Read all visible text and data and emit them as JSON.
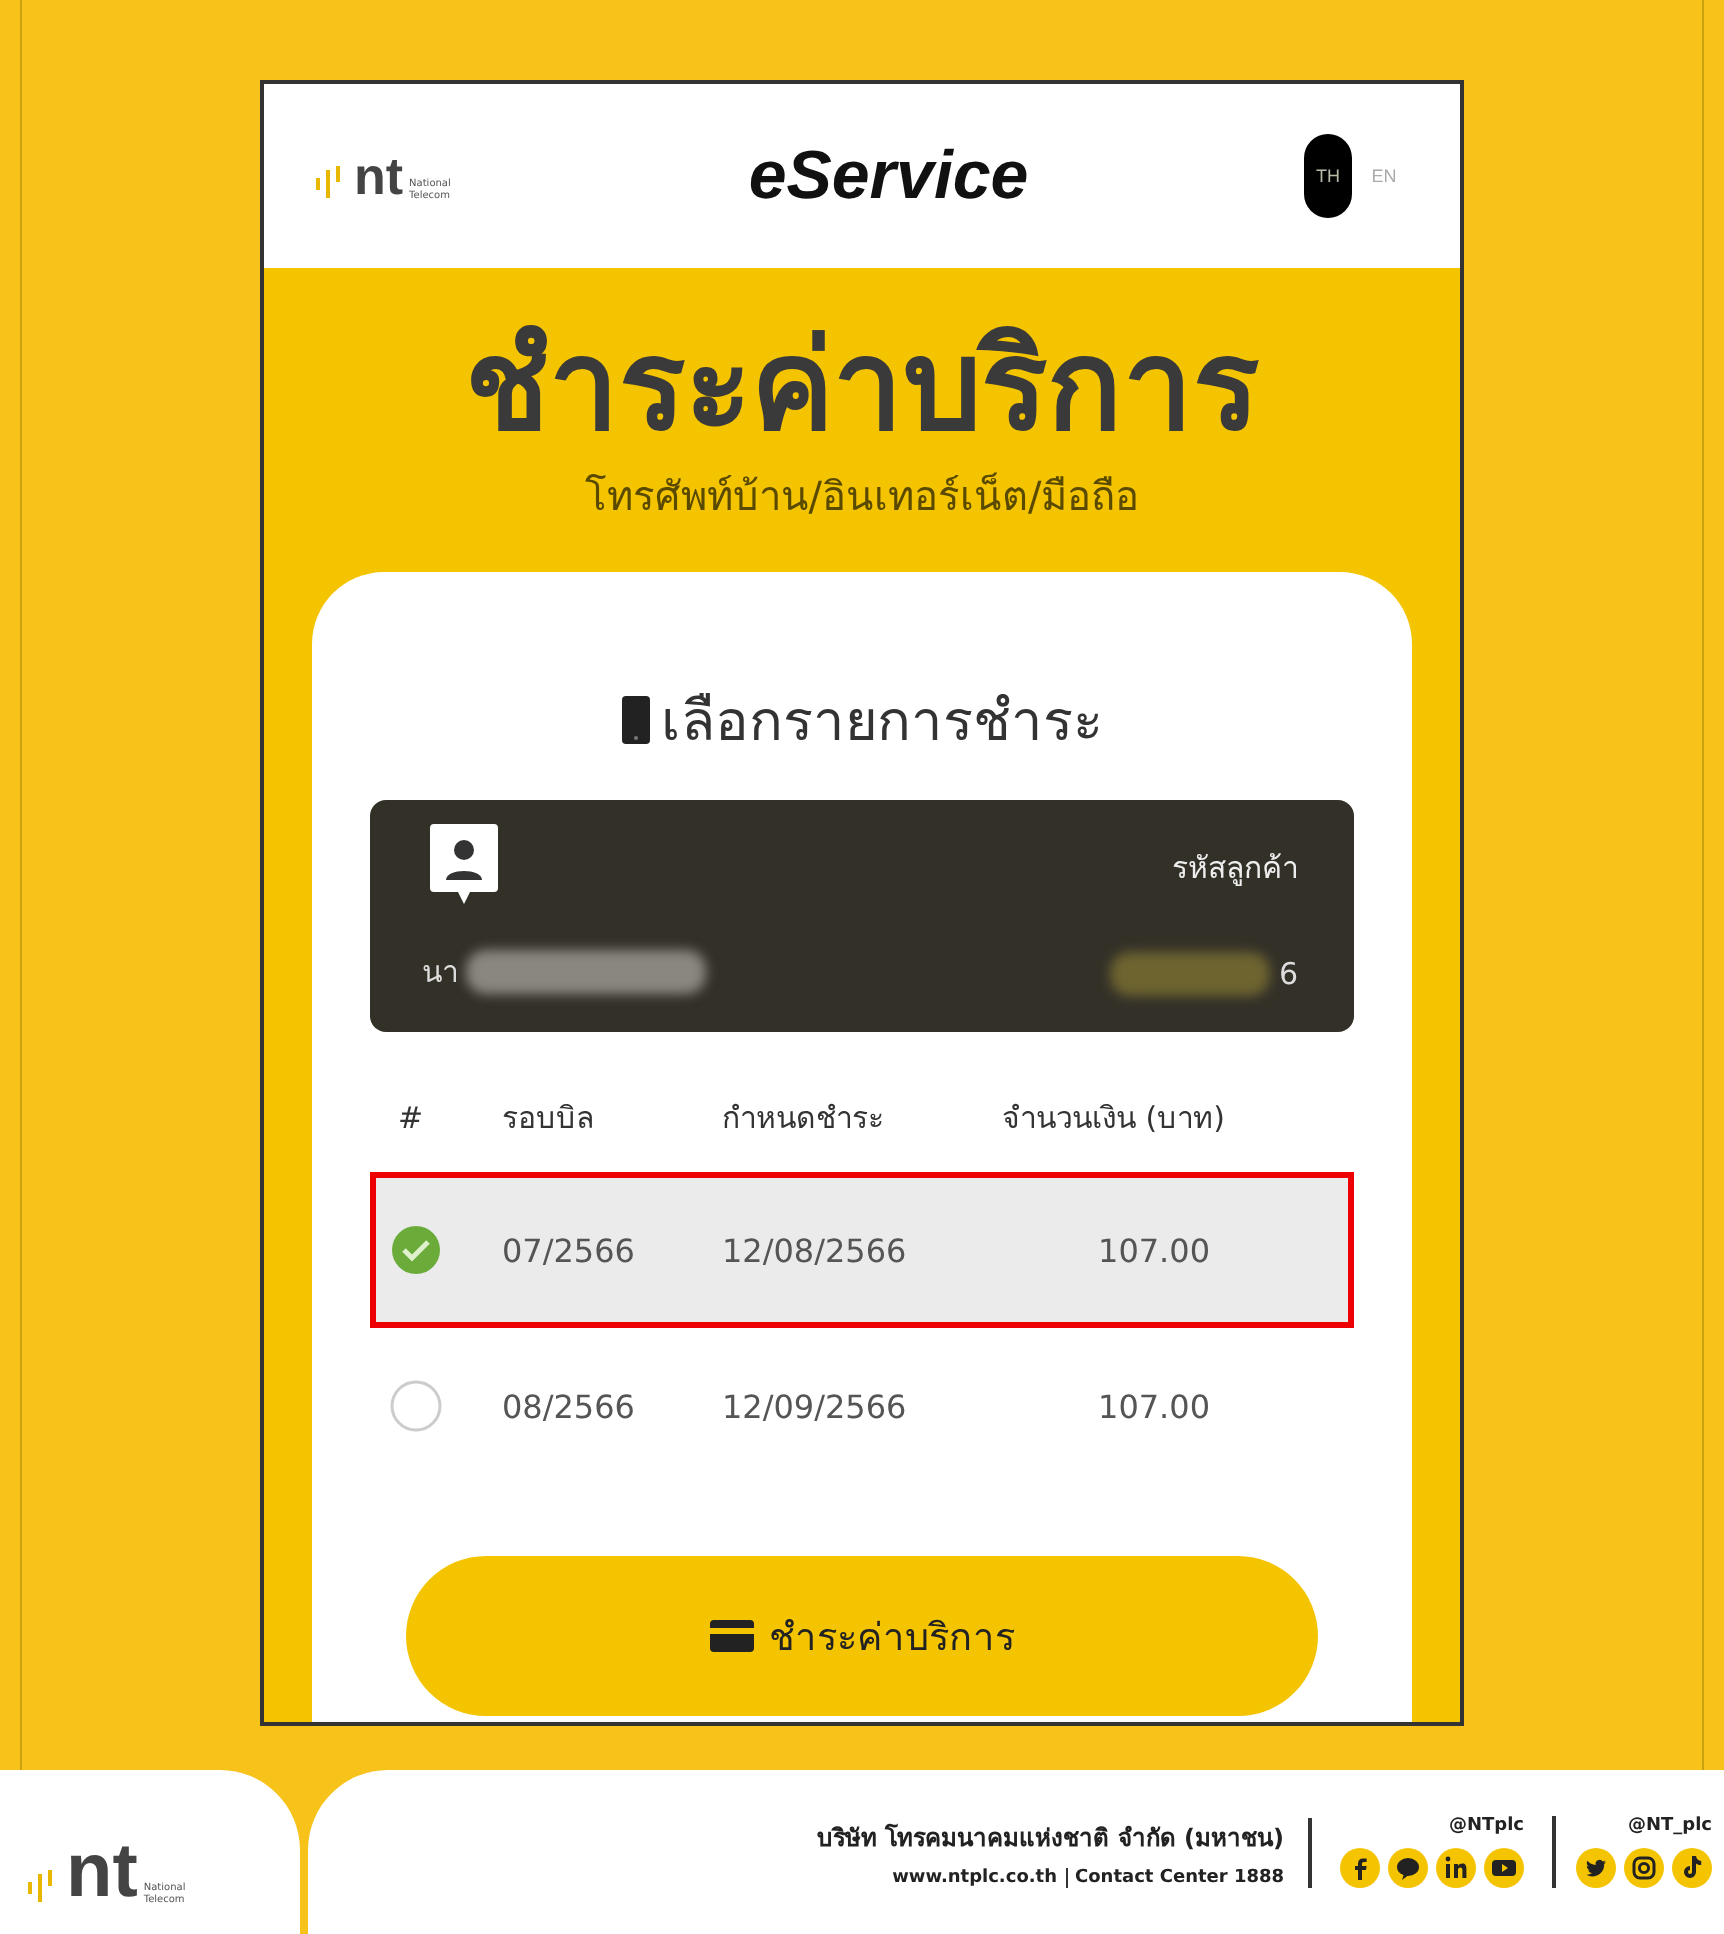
{
  "header": {
    "app_title": "eService",
    "logo_text": "nt",
    "logo_subtext": "National Telecom",
    "languages": [
      {
        "label": "TH",
        "selected": true
      },
      {
        "label": "EN",
        "selected": false
      }
    ]
  },
  "hero": {
    "title": "ชำระค่าบริการ",
    "subtitle": "โทรศัพท์บ้าน/อินเทอร์เน็ต/มือถือ"
  },
  "panel": {
    "heading": "เลือกรายการชำระ",
    "customer": {
      "code_label": "รหัสลูกค้า",
      "name_visible": "นา",
      "code_visible": "6"
    },
    "table": {
      "columns": [
        "#",
        "รอบบิล",
        "กำหนดชำระ",
        "จำนวนเงิน (บาท)"
      ],
      "rows": [
        {
          "selected": true,
          "highlighted": true,
          "cycle": "07/2566",
          "due": "12/08/2566",
          "amount": "107.00"
        },
        {
          "selected": false,
          "highlighted": false,
          "cycle": "08/2566",
          "due": "12/09/2566",
          "amount": "107.00"
        }
      ]
    },
    "pay_button": "ชำระค่าบริการ"
  },
  "footer": {
    "logo_text": "nt",
    "logo_subtext": "National Telecom",
    "company": "บริษัท โทรคมนาคมแห่งชาติ จำกัด (มหาชน)",
    "website": "www.ntplc.co.th",
    "contact": "Contact Center 1888",
    "social_groups": [
      {
        "handle": "@NTplc",
        "icons": [
          {
            "kind": "facebook"
          },
          {
            "kind": "line"
          },
          {
            "kind": "linkedin"
          },
          {
            "kind": "youtube"
          }
        ]
      },
      {
        "handle": "@NT_plc",
        "icons": [
          {
            "kind": "twitter"
          },
          {
            "kind": "instagram"
          },
          {
            "kind": "tiktok"
          }
        ]
      }
    ]
  }
}
